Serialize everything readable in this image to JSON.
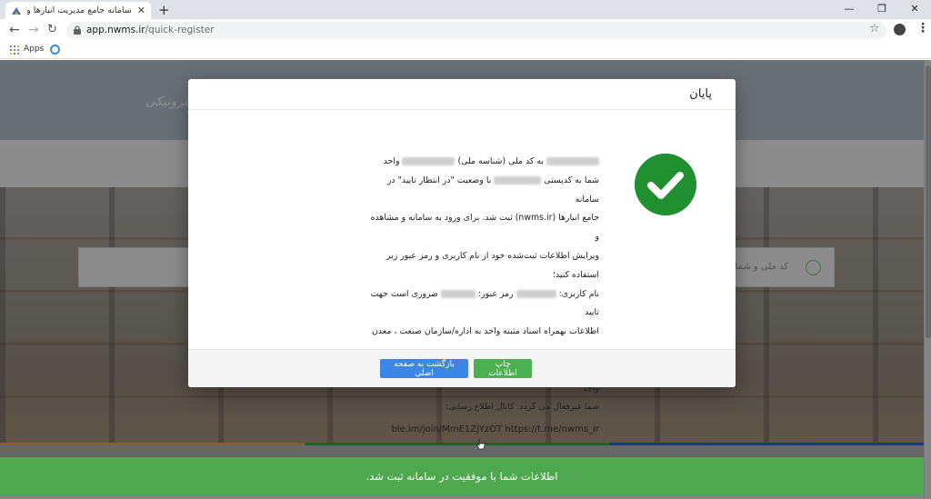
{
  "browser": {
    "tab_title": "سامانه جامع مدیریت انبارها و مراکز",
    "tab_close": "✕",
    "new_tab": "+",
    "window_controls": [
      "—",
      "❐",
      "✕"
    ],
    "url_host": "app.nwms.ir",
    "url_path": "/quick-register",
    "bookmarks": [
      {
        "label": "Apps"
      }
    ]
  },
  "page": {
    "header_logo": "الکترونیکی",
    "search_placeholder": "کد ملی و شماره ملی"
  },
  "modal": {
    "title": "پایان",
    "lines": [
      [
        "",
        "به کد ملی (شناسه ملی)",
        "",
        "واحد"
      ],
      [
        "شما به کدپستی",
        "",
        "با وضعیت \"در انتظار تایید\" در سامانه"
      ],
      [
        "جامع انبارها (nwms.ir) ثبت شد. برای ورود به سامانه و مشاهده و"
      ],
      [
        "ویرایش اطلاعات ثبت‌شده خود از نام کاربری و رمز عبور زیر استفاده کنید؛"
      ],
      [
        "نام کاربری:",
        "",
        "رمز عبور:",
        "",
        "ضروری است جهت تایید"
      ],
      [
        "اطلاعات بهمراه اسناد مثبته واحد به اداره/سازمان صنعت ، معدن و"
      ],
      [
        "تجارت مراجعه نمائید. در صورت عدم تایید ظرف مدت یک ماه، واحد"
      ],
      [
        "شما غیرفعال می گردد. کانال اطلاع رسانی:"
      ]
    ],
    "channel_link": "ble.im/join/MmE1ZjYzOT https://t.me/nwms_ir",
    "buttons": {
      "print": "چاپ اطلاعات",
      "home": "بازگشت به صفحه اصلی"
    }
  },
  "toast": {
    "message": "اطلاعات شما با موفقیت در سامانه ثبت شد."
  },
  "colors": {
    "success": "#4fa84f",
    "check": "#1f8f2f",
    "primary": "#3c86e8",
    "print_button": "#4caf50"
  }
}
